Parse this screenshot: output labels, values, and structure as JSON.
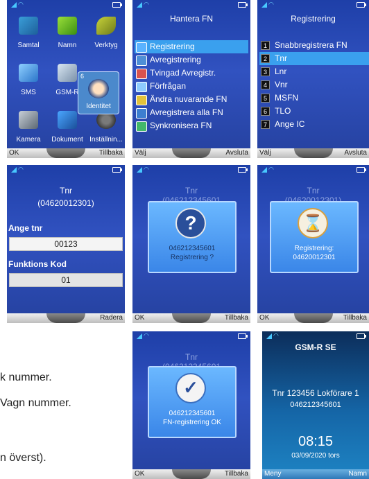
{
  "screen1": {
    "menu_items": [
      "Samtal",
      "Namn",
      "Verktyg",
      "SMS",
      "GSM-R",
      "Identitet",
      "Kamera",
      "Dokument",
      "Inställnin..."
    ],
    "popup_label": "Identitet",
    "popup_num": "6",
    "soft_left": "OK",
    "soft_right": "Tillbaka"
  },
  "screen2": {
    "title": "Hantera FN",
    "items": [
      "Registrering",
      "Avregistrering",
      "Tvingad Avregistr.",
      "Förfrågan",
      "Ändra nuvarande FN",
      "Avregistrera alla FN",
      "Synkronisera FN"
    ],
    "soft_left": "Välj",
    "soft_right": "Avsluta"
  },
  "screen3": {
    "title": "Registrering",
    "items": [
      {
        "num": "1",
        "label": "Snabbregistrera FN"
      },
      {
        "num": "2",
        "label": "Tnr"
      },
      {
        "num": "3",
        "label": "Lnr"
      },
      {
        "num": "4",
        "label": "Vnr"
      },
      {
        "num": "5",
        "label": "MSFN"
      },
      {
        "num": "6",
        "label": "TLO"
      },
      {
        "num": "7",
        "label": "Ange IC"
      }
    ],
    "soft_left": "Välj",
    "soft_right": "Avsluta"
  },
  "screen4": {
    "title": "Tnr",
    "subtitle": "(04620012301)",
    "field1_label": "Ange tnr",
    "field1_value": "00123",
    "field2_label": "Funktions Kod",
    "field2_value": "01",
    "soft_right": "Radera"
  },
  "screen5": {
    "ghost_title": "Tnr",
    "ghost_sub": "(046212345601",
    "dialog_line1": "046212345601",
    "dialog_line2": "Registrering ?",
    "soft_left": "OK",
    "soft_right": "Tillbaka"
  },
  "screen6": {
    "ghost_title": "Tnr",
    "ghost_sub": "(04620012301)",
    "dialog_line1": "Registrering:",
    "dialog_line2": "04620012301",
    "soft_left": "OK",
    "soft_right": "Tillbaka"
  },
  "screen7": {
    "ghost_title": "Tnr",
    "ghost_sub": "(046212345601",
    "dialog_line1": "046212345601",
    "dialog_line2": "FN-registrering OK",
    "soft_left": "OK",
    "soft_right": "Tillbaka"
  },
  "screen8": {
    "network": "GSM-R SE",
    "line1": "Tnr 123456 Lokförare 1",
    "line2": "046212345601",
    "time": "08:15",
    "date": "03/09/2020 tors",
    "soft_left": "Meny",
    "soft_right": "Namn"
  },
  "doc_text": [
    "k nummer.",
    "Vagn nummer.",
    "n överst)."
  ]
}
